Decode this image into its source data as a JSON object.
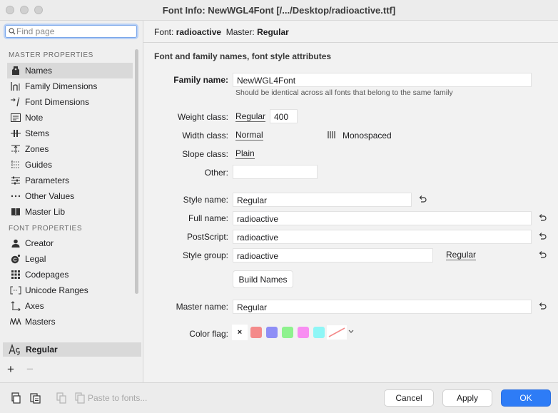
{
  "window": {
    "title": "Font Info: NewWGL4Font [/.../Desktop/radioactive.ttf]"
  },
  "sidebar": {
    "search_placeholder": "Find page",
    "master_section": "MASTER PROPERTIES",
    "master_items": [
      {
        "label": "Names",
        "icon": "tag-icon"
      },
      {
        "label": "Family Dimensions",
        "icon": "family-dimensions-icon"
      },
      {
        "label": "Font Dimensions",
        "icon": "font-dimensions-icon"
      },
      {
        "label": "Note",
        "icon": "note-icon"
      },
      {
        "label": "Stems",
        "icon": "stems-icon"
      },
      {
        "label": "Zones",
        "icon": "zones-icon"
      },
      {
        "label": "Guides",
        "icon": "guides-icon"
      },
      {
        "label": "Parameters",
        "icon": "parameters-icon"
      },
      {
        "label": "Other Values",
        "icon": "ellipsis-icon"
      },
      {
        "label": "Master Lib",
        "icon": "book-icon"
      }
    ],
    "font_section": "FONT PROPERTIES",
    "font_items": [
      {
        "label": "Creator",
        "icon": "person-icon"
      },
      {
        "label": "Legal",
        "icon": "copyright-icon"
      },
      {
        "label": "Codepages",
        "icon": "grid-icon"
      },
      {
        "label": "Unicode Ranges",
        "icon": "bracket-icon"
      },
      {
        "label": "Axes",
        "icon": "axes-icon"
      },
      {
        "label": "Masters",
        "icon": "masters-icon"
      }
    ],
    "selected_master": "Regular"
  },
  "header": {
    "font_label": "Font:",
    "font_value": "radioactive",
    "master_label": "Master:",
    "master_value": "Regular"
  },
  "panel": {
    "title": "Font and family names, font style attributes",
    "family_name_label": "Family name:",
    "family_name_value": "NewWGL4Font",
    "family_hint": "Should be identical across all fonts that belong to the same family",
    "weight_label": "Weight class:",
    "weight_value": "Regular",
    "weight_number": "400",
    "width_label": "Width class:",
    "width_value": "Normal",
    "monospaced_label": "Monospaced",
    "slope_label": "Slope class:",
    "slope_value": "Plain",
    "other_label": "Other:",
    "other_value": "",
    "style_name_label": "Style name:",
    "style_name_value": "Regular",
    "full_name_label": "Full name:",
    "full_name_value": "radioactive",
    "postscript_label": "PostScript:",
    "postscript_value": "radioactive",
    "style_group_label": "Style group:",
    "style_group_value": "radioactive",
    "style_group_style": "Regular",
    "build_names_label": "Build Names",
    "master_name_label": "Master name:",
    "master_name_value": "Regular",
    "color_flag_label": "Color flag:",
    "color_flag_none": "×",
    "color_flags": [
      "#f48a8a",
      "#8e8ef6",
      "#8ef28e",
      "#f88ef2",
      "#8ef6f6"
    ]
  },
  "footer": {
    "paste_label": "Paste to fonts...",
    "cancel": "Cancel",
    "apply": "Apply",
    "ok": "OK"
  }
}
